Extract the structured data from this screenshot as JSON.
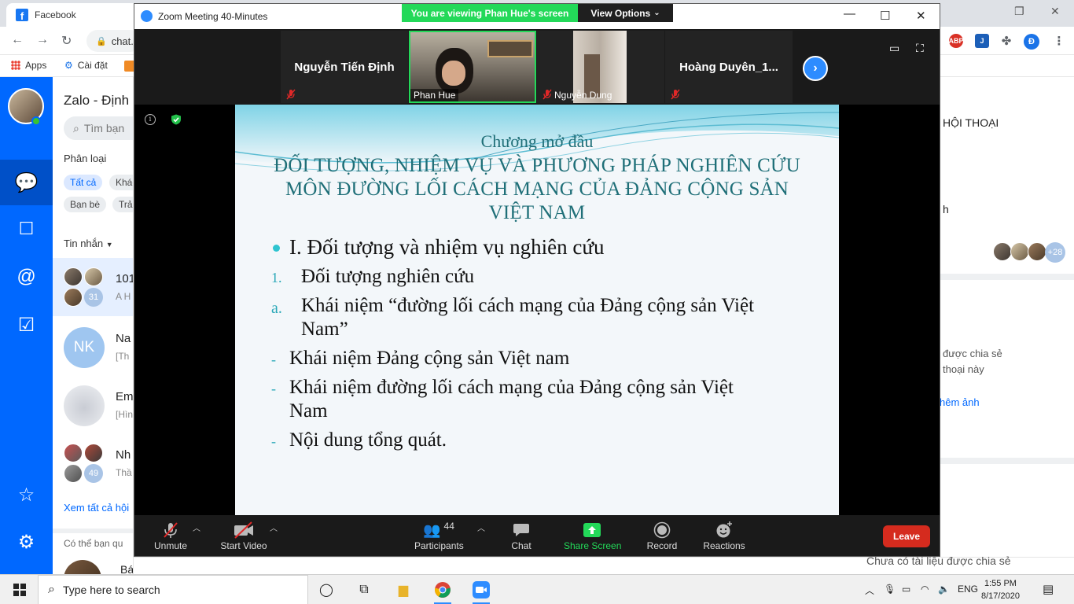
{
  "browser": {
    "tab_title": "Facebook",
    "address": "chat.",
    "bookmarks": {
      "apps": "Apps",
      "settings": "Cài đặt"
    },
    "extensions": {
      "abp": "ABP",
      "profile": "Đ"
    }
  },
  "zalo": {
    "title": "Zalo - Định",
    "search_placeholder": "Tìm bạn",
    "filter_label": "Phân loại",
    "chips": {
      "all": "Tất cả",
      "other": "Khác",
      "friends": "Bạn bè",
      "reply": "Trả"
    },
    "messages_label": "Tin nhắn",
    "conversations": [
      {
        "name": "101",
        "preview": "A H",
        "count": "31"
      },
      {
        "name": "Na",
        "preview": "[Th",
        "initials": "NK"
      },
      {
        "name": "Em",
        "preview": "[Hìn"
      },
      {
        "name": "Nh",
        "preview": "Thầ",
        "count": "49"
      }
    ],
    "see_all": "Xem tất cả hội",
    "suggest_label": "Có thể bạn qu",
    "suggest_name": "Bánh Sinh Nha",
    "right_panel": {
      "heading": "HỘI THOẠI",
      "letter": "h",
      "member_count": "+28",
      "shared_line1": "được chia sẻ",
      "shared_line2": "thoại này",
      "view_photos": "hêm ảnh",
      "no_files": "Chưa có tài liệu được chia sẻ"
    }
  },
  "zoom": {
    "window_title": "Zoom Meeting 40-Minutes",
    "viewing_banner": "You are viewing Phan Hue's screen",
    "view_options": "View Options",
    "participants_tiles": [
      {
        "name": "Nguyễn Tiến Định"
      },
      {
        "name": "Phan Hue"
      },
      {
        "name": "Nguyễn Dung"
      },
      {
        "name": "Hoàng  Duyên_1..."
      }
    ],
    "toolbar": {
      "unmute": "Unmute",
      "start_video": "Start Video",
      "participants": "Participants",
      "participants_count": "44",
      "chat": "Chat",
      "share_screen": "Share Screen",
      "record": "Record",
      "reactions": "Reactions",
      "leave": "Leave"
    }
  },
  "slide": {
    "kicker": "Chương mở đầu",
    "title_lines": [
      "ĐỐI TƯỢNG, NHIỆM VỤ VÀ PHƯƠNG PHÁP NGHIÊN CỨU",
      "MÔN ĐƯỜNG LỐI CÁCH MẠNG CỦA ĐẢNG CỘNG SẢN",
      "VIỆT NAM"
    ],
    "heading": "I. Đối tượng và nhiệm vụ nghiên cứu",
    "item1_marker": "1.",
    "item1": "Đối tượng nghiên cứu",
    "itema_marker": "a.",
    "itema_line1": "Khái niệm “đường lối cách mạng của Đảng cộng sản Việt",
    "itema_line2": "Nam”",
    "dash": "-",
    "dash1": "Khái niệm Đảng cộng sản Việt nam",
    "dash2_line1": "Khái niệm đường lối cách mạng của Đảng cộng sản Việt",
    "dash2_line2": "Nam",
    "dash3": "Nội dung tổng quát."
  },
  "taskbar": {
    "search_placeholder": "Type here to search",
    "language": "ENG",
    "time": "1:55 PM",
    "date": "8/17/2020"
  }
}
